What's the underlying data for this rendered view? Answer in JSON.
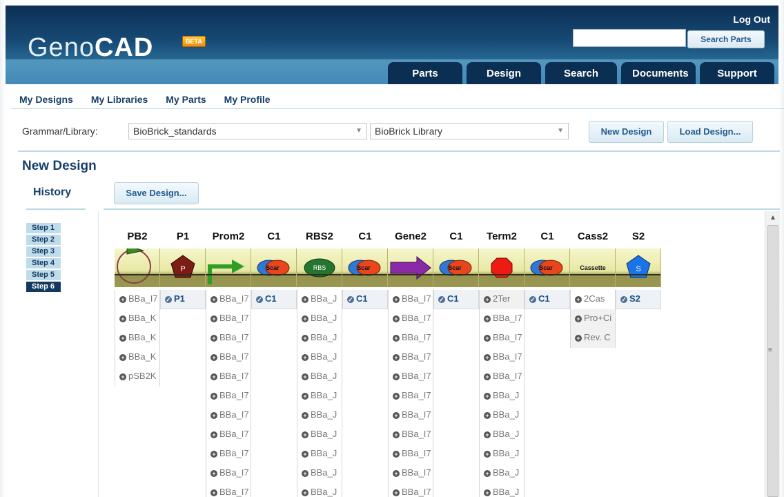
{
  "header": {
    "logo_light": "Geno",
    "logo_bold": "CAD",
    "beta": "BETA",
    "logout": "Log Out",
    "search_button": "Search Parts",
    "search_placeholder": "",
    "tabs": [
      {
        "label": "Parts"
      },
      {
        "label": "Design"
      },
      {
        "label": "Search"
      },
      {
        "label": "Documents"
      },
      {
        "label": "Support"
      }
    ]
  },
  "subnav": [
    {
      "label": "My Designs"
    },
    {
      "label": "My Libraries"
    },
    {
      "label": "My Parts"
    },
    {
      "label": "My Profile"
    }
  ],
  "grammar": {
    "label": "Grammar/Library:",
    "grammar_value": "BioBrick_standards",
    "library_value": "BioBrick Library",
    "new_design": "New Design",
    "load_design": "Load Design..."
  },
  "page_title": "New Design",
  "history": {
    "title": "History",
    "save_design": "Save Design...",
    "steps": [
      "Step 1",
      "Step 2",
      "Step 3",
      "Step 4",
      "Step 5",
      "Step 6"
    ],
    "active_step": 6
  },
  "design": {
    "columns": [
      {
        "title": "PB2",
        "icon": "plasmid-backbone-icon",
        "items": [
          {
            "text": "BBa_I7",
            "selected": false
          },
          {
            "text": "BBa_K",
            "selected": false
          },
          {
            "text": "BBa_K",
            "selected": false
          },
          {
            "text": "BBa_K",
            "selected": false
          },
          {
            "text": "pSB2K",
            "selected": false
          }
        ]
      },
      {
        "title": "P1",
        "icon": "pentagon-p-icon",
        "items": [
          {
            "text": "P1",
            "selected": true
          }
        ]
      },
      {
        "title": "Prom2",
        "icon": "promoter-arrow-icon",
        "items": [
          {
            "text": "BBa_I7",
            "selected": false
          },
          {
            "text": "BBa_I7",
            "selected": false
          },
          {
            "text": "BBa_I7",
            "selected": false
          },
          {
            "text": "BBa_I7",
            "selected": false
          },
          {
            "text": "BBa_I7",
            "selected": false
          },
          {
            "text": "BBa_I7",
            "selected": false
          },
          {
            "text": "BBa_I7",
            "selected": false
          },
          {
            "text": "BBa_I7",
            "selected": false
          },
          {
            "text": "BBa_I7",
            "selected": false
          },
          {
            "text": "BBa_I7",
            "selected": false
          },
          {
            "text": "BBa_I7",
            "selected": false
          }
        ]
      },
      {
        "title": "C1",
        "icon": "scar-icon",
        "items": [
          {
            "text": "C1",
            "selected": true
          }
        ]
      },
      {
        "title": "RBS2",
        "icon": "rbs-icon",
        "items": [
          {
            "text": "BBa_J",
            "selected": false
          },
          {
            "text": "BBa_J",
            "selected": false
          },
          {
            "text": "BBa_J",
            "selected": false
          },
          {
            "text": "BBa_J",
            "selected": false
          },
          {
            "text": "BBa_J",
            "selected": false
          },
          {
            "text": "BBa_J",
            "selected": false
          },
          {
            "text": "BBa_J",
            "selected": false
          },
          {
            "text": "BBa_J",
            "selected": false
          },
          {
            "text": "BBa_J",
            "selected": false
          },
          {
            "text": "BBa_J",
            "selected": false
          },
          {
            "text": "BBa_J",
            "selected": false
          }
        ]
      },
      {
        "title": "C1",
        "icon": "scar-icon",
        "items": [
          {
            "text": "C1",
            "selected": true
          }
        ]
      },
      {
        "title": "Gene2",
        "icon": "gene-arrow-icon",
        "items": [
          {
            "text": "BBa_I7",
            "selected": false
          },
          {
            "text": "BBa_I7",
            "selected": false
          },
          {
            "text": "BBa_I7",
            "selected": false
          },
          {
            "text": "BBa_I7",
            "selected": false
          },
          {
            "text": "BBa_I7",
            "selected": false
          },
          {
            "text": "BBa_I7",
            "selected": false
          },
          {
            "text": "BBa_I7",
            "selected": false
          },
          {
            "text": "BBa_I7",
            "selected": false
          },
          {
            "text": "BBa_I7",
            "selected": false
          },
          {
            "text": "BBa_I7",
            "selected": false
          },
          {
            "text": "BBa_I7",
            "selected": false
          }
        ]
      },
      {
        "title": "C1",
        "icon": "scar-icon",
        "items": [
          {
            "text": "C1",
            "selected": true
          }
        ]
      },
      {
        "title": "Term2",
        "icon": "terminator-icon",
        "items": [
          {
            "text": "2Ter",
            "selected": false,
            "grey": true
          },
          {
            "text": "BBa_I7",
            "selected": false
          },
          {
            "text": "BBa_I7",
            "selected": false
          },
          {
            "text": "BBa_I7",
            "selected": false
          },
          {
            "text": "BBa_I7",
            "selected": false
          },
          {
            "text": "BBa_J",
            "selected": false
          },
          {
            "text": "BBa_J",
            "selected": false
          },
          {
            "text": "BBa_J",
            "selected": false
          },
          {
            "text": "BBa_J",
            "selected": false
          },
          {
            "text": "BBa_J",
            "selected": false
          },
          {
            "text": "BBa_J",
            "selected": false
          }
        ]
      },
      {
        "title": "C1",
        "icon": "scar-icon",
        "items": [
          {
            "text": "C1",
            "selected": true
          }
        ]
      },
      {
        "title": "Cass2",
        "icon": "cassette-icon",
        "items": [
          {
            "text": "2Cas",
            "selected": false
          },
          {
            "text": "Pro+Ci",
            "selected": false,
            "grey": true
          },
          {
            "text": "Rev. C",
            "selected": false,
            "grey": true
          }
        ]
      },
      {
        "title": "S2",
        "icon": "pentagon-s-icon",
        "items": [
          {
            "text": "S2",
            "selected": true
          }
        ]
      }
    ],
    "icon_labels": {
      "pentagon_p": "P",
      "scar": "Scar",
      "rbs": "RBS",
      "cassette": "Cassette",
      "pentagon_s": "S"
    }
  },
  "colors": {
    "header_dark": "#0d2f55",
    "accent_blue": "#173f6a",
    "step_active": "#123a5f",
    "step_inactive": "#bfdcec"
  }
}
